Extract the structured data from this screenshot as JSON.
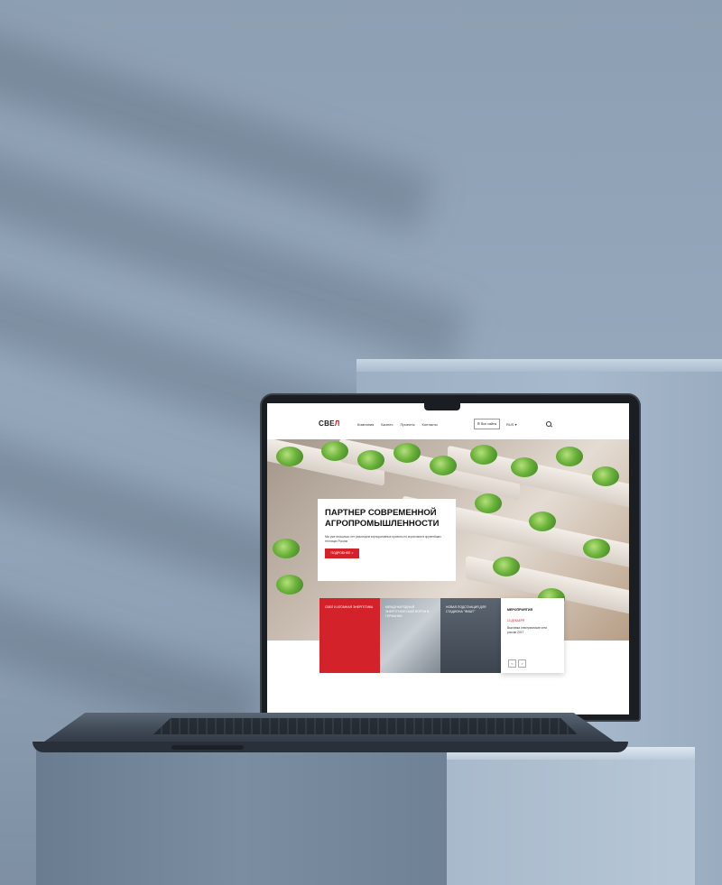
{
  "site": {
    "logo_main": "СВЕ",
    "logo_accent": "Л",
    "nav": [
      "Компания",
      "Бизнес",
      "Проекты",
      "Контакты"
    ],
    "all_sites_label": "☰ Все сайты",
    "lang_label": "RUS",
    "lang_icon": "chevron-down-icon",
    "search_icon": "search-icon"
  },
  "hero": {
    "title": "ПАРТНЕР СОВРЕМЕННОЙ АГРОПРОМЫШЛЕННОСТИ",
    "subtitle": "Мы уже несколько лет реализуем корпоративные проекты по агрономии в крупнейших теплицах России",
    "button_label": "ПОДРОБНЕЕ >"
  },
  "tiles": [
    {
      "label": "СВЕЛ И АТОМНАЯ ЭНЕРГЕТИКА"
    },
    {
      "label": "МЕЖДУНАРОДНЫЙ ЭНЕРГЕТИЧЕСКИЙ ФОРУМ В ГЕРМАНИИ"
    },
    {
      "label": "НОВАЯ ПОДСТАНЦИЯ ДЛЯ СТАДИОНА \"ФИШТ\""
    }
  ],
  "events": {
    "title": "МЕРОПРИЯТИЯ",
    "date": "13 ДЕКАБРЯ",
    "text": "Выставка электрические сети россии 2017",
    "prev": "<",
    "next": ">"
  },
  "colors": {
    "accent": "#d3222a",
    "background": "#8fa2b5"
  }
}
